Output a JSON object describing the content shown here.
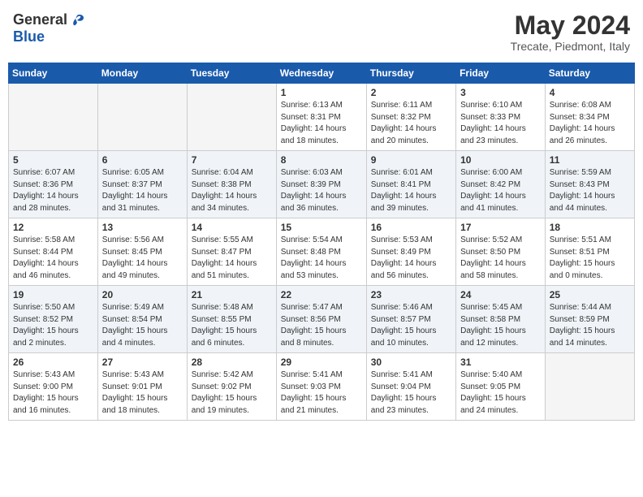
{
  "header": {
    "logo_general": "General",
    "logo_blue": "Blue",
    "month_year": "May 2024",
    "location": "Trecate, Piedmont, Italy"
  },
  "days_of_week": [
    "Sunday",
    "Monday",
    "Tuesday",
    "Wednesday",
    "Thursday",
    "Friday",
    "Saturday"
  ],
  "weeks": [
    {
      "days": [
        {
          "num": "",
          "info": ""
        },
        {
          "num": "",
          "info": ""
        },
        {
          "num": "",
          "info": ""
        },
        {
          "num": "1",
          "info": "Sunrise: 6:13 AM\nSunset: 8:31 PM\nDaylight: 14 hours\nand 18 minutes."
        },
        {
          "num": "2",
          "info": "Sunrise: 6:11 AM\nSunset: 8:32 PM\nDaylight: 14 hours\nand 20 minutes."
        },
        {
          "num": "3",
          "info": "Sunrise: 6:10 AM\nSunset: 8:33 PM\nDaylight: 14 hours\nand 23 minutes."
        },
        {
          "num": "4",
          "info": "Sunrise: 6:08 AM\nSunset: 8:34 PM\nDaylight: 14 hours\nand 26 minutes."
        }
      ]
    },
    {
      "days": [
        {
          "num": "5",
          "info": "Sunrise: 6:07 AM\nSunset: 8:36 PM\nDaylight: 14 hours\nand 28 minutes."
        },
        {
          "num": "6",
          "info": "Sunrise: 6:05 AM\nSunset: 8:37 PM\nDaylight: 14 hours\nand 31 minutes."
        },
        {
          "num": "7",
          "info": "Sunrise: 6:04 AM\nSunset: 8:38 PM\nDaylight: 14 hours\nand 34 minutes."
        },
        {
          "num": "8",
          "info": "Sunrise: 6:03 AM\nSunset: 8:39 PM\nDaylight: 14 hours\nand 36 minutes."
        },
        {
          "num": "9",
          "info": "Sunrise: 6:01 AM\nSunset: 8:41 PM\nDaylight: 14 hours\nand 39 minutes."
        },
        {
          "num": "10",
          "info": "Sunrise: 6:00 AM\nSunset: 8:42 PM\nDaylight: 14 hours\nand 41 minutes."
        },
        {
          "num": "11",
          "info": "Sunrise: 5:59 AM\nSunset: 8:43 PM\nDaylight: 14 hours\nand 44 minutes."
        }
      ]
    },
    {
      "days": [
        {
          "num": "12",
          "info": "Sunrise: 5:58 AM\nSunset: 8:44 PM\nDaylight: 14 hours\nand 46 minutes."
        },
        {
          "num": "13",
          "info": "Sunrise: 5:56 AM\nSunset: 8:45 PM\nDaylight: 14 hours\nand 49 minutes."
        },
        {
          "num": "14",
          "info": "Sunrise: 5:55 AM\nSunset: 8:47 PM\nDaylight: 14 hours\nand 51 minutes."
        },
        {
          "num": "15",
          "info": "Sunrise: 5:54 AM\nSunset: 8:48 PM\nDaylight: 14 hours\nand 53 minutes."
        },
        {
          "num": "16",
          "info": "Sunrise: 5:53 AM\nSunset: 8:49 PM\nDaylight: 14 hours\nand 56 minutes."
        },
        {
          "num": "17",
          "info": "Sunrise: 5:52 AM\nSunset: 8:50 PM\nDaylight: 14 hours\nand 58 minutes."
        },
        {
          "num": "18",
          "info": "Sunrise: 5:51 AM\nSunset: 8:51 PM\nDaylight: 15 hours\nand 0 minutes."
        }
      ]
    },
    {
      "days": [
        {
          "num": "19",
          "info": "Sunrise: 5:50 AM\nSunset: 8:52 PM\nDaylight: 15 hours\nand 2 minutes."
        },
        {
          "num": "20",
          "info": "Sunrise: 5:49 AM\nSunset: 8:54 PM\nDaylight: 15 hours\nand 4 minutes."
        },
        {
          "num": "21",
          "info": "Sunrise: 5:48 AM\nSunset: 8:55 PM\nDaylight: 15 hours\nand 6 minutes."
        },
        {
          "num": "22",
          "info": "Sunrise: 5:47 AM\nSunset: 8:56 PM\nDaylight: 15 hours\nand 8 minutes."
        },
        {
          "num": "23",
          "info": "Sunrise: 5:46 AM\nSunset: 8:57 PM\nDaylight: 15 hours\nand 10 minutes."
        },
        {
          "num": "24",
          "info": "Sunrise: 5:45 AM\nSunset: 8:58 PM\nDaylight: 15 hours\nand 12 minutes."
        },
        {
          "num": "25",
          "info": "Sunrise: 5:44 AM\nSunset: 8:59 PM\nDaylight: 15 hours\nand 14 minutes."
        }
      ]
    },
    {
      "days": [
        {
          "num": "26",
          "info": "Sunrise: 5:43 AM\nSunset: 9:00 PM\nDaylight: 15 hours\nand 16 minutes."
        },
        {
          "num": "27",
          "info": "Sunrise: 5:43 AM\nSunset: 9:01 PM\nDaylight: 15 hours\nand 18 minutes."
        },
        {
          "num": "28",
          "info": "Sunrise: 5:42 AM\nSunset: 9:02 PM\nDaylight: 15 hours\nand 19 minutes."
        },
        {
          "num": "29",
          "info": "Sunrise: 5:41 AM\nSunset: 9:03 PM\nDaylight: 15 hours\nand 21 minutes."
        },
        {
          "num": "30",
          "info": "Sunrise: 5:41 AM\nSunset: 9:04 PM\nDaylight: 15 hours\nand 23 minutes."
        },
        {
          "num": "31",
          "info": "Sunrise: 5:40 AM\nSunset: 9:05 PM\nDaylight: 15 hours\nand 24 minutes."
        },
        {
          "num": "",
          "info": ""
        }
      ]
    }
  ]
}
